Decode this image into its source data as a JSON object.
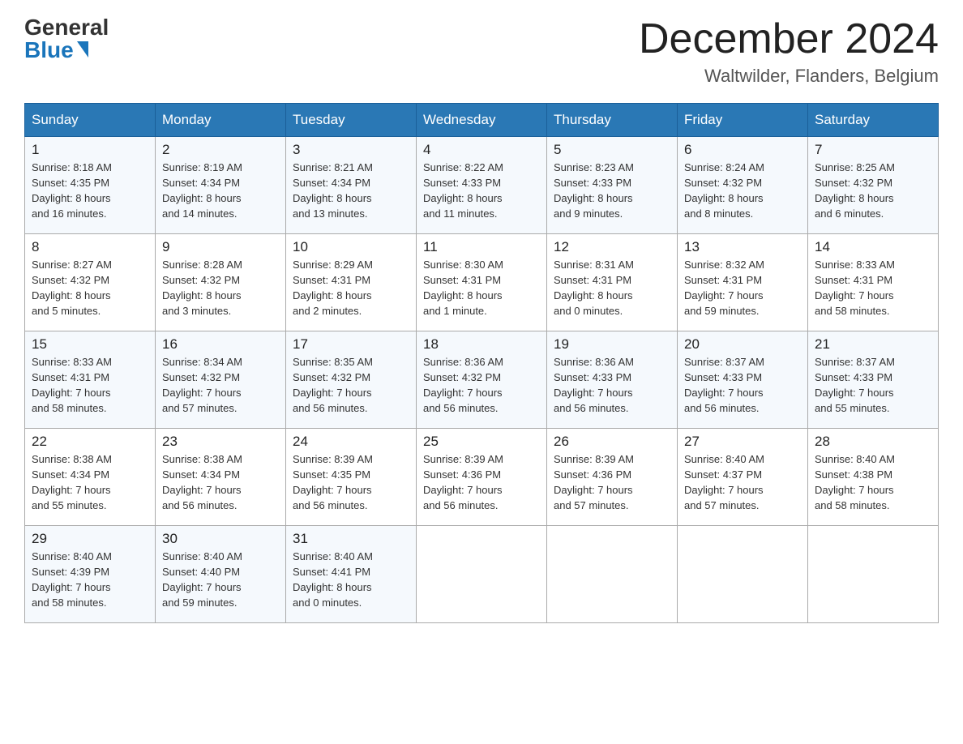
{
  "logo": {
    "general": "General",
    "blue": "Blue"
  },
  "title": "December 2024",
  "location": "Waltwilder, Flanders, Belgium",
  "weekdays": [
    "Sunday",
    "Monday",
    "Tuesday",
    "Wednesday",
    "Thursday",
    "Friday",
    "Saturday"
  ],
  "weeks": [
    [
      {
        "day": "1",
        "sunrise": "8:18 AM",
        "sunset": "4:35 PM",
        "daylight": "8 hours and 16 minutes."
      },
      {
        "day": "2",
        "sunrise": "8:19 AM",
        "sunset": "4:34 PM",
        "daylight": "8 hours and 14 minutes."
      },
      {
        "day": "3",
        "sunrise": "8:21 AM",
        "sunset": "4:34 PM",
        "daylight": "8 hours and 13 minutes."
      },
      {
        "day": "4",
        "sunrise": "8:22 AM",
        "sunset": "4:33 PM",
        "daylight": "8 hours and 11 minutes."
      },
      {
        "day": "5",
        "sunrise": "8:23 AM",
        "sunset": "4:33 PM",
        "daylight": "8 hours and 9 minutes."
      },
      {
        "day": "6",
        "sunrise": "8:24 AM",
        "sunset": "4:32 PM",
        "daylight": "8 hours and 8 minutes."
      },
      {
        "day": "7",
        "sunrise": "8:25 AM",
        "sunset": "4:32 PM",
        "daylight": "8 hours and 6 minutes."
      }
    ],
    [
      {
        "day": "8",
        "sunrise": "8:27 AM",
        "sunset": "4:32 PM",
        "daylight": "8 hours and 5 minutes."
      },
      {
        "day": "9",
        "sunrise": "8:28 AM",
        "sunset": "4:32 PM",
        "daylight": "8 hours and 3 minutes."
      },
      {
        "day": "10",
        "sunrise": "8:29 AM",
        "sunset": "4:31 PM",
        "daylight": "8 hours and 2 minutes."
      },
      {
        "day": "11",
        "sunrise": "8:30 AM",
        "sunset": "4:31 PM",
        "daylight": "8 hours and 1 minute."
      },
      {
        "day": "12",
        "sunrise": "8:31 AM",
        "sunset": "4:31 PM",
        "daylight": "8 hours and 0 minutes."
      },
      {
        "day": "13",
        "sunrise": "8:32 AM",
        "sunset": "4:31 PM",
        "daylight": "7 hours and 59 minutes."
      },
      {
        "day": "14",
        "sunrise": "8:33 AM",
        "sunset": "4:31 PM",
        "daylight": "7 hours and 58 minutes."
      }
    ],
    [
      {
        "day": "15",
        "sunrise": "8:33 AM",
        "sunset": "4:31 PM",
        "daylight": "7 hours and 58 minutes."
      },
      {
        "day": "16",
        "sunrise": "8:34 AM",
        "sunset": "4:32 PM",
        "daylight": "7 hours and 57 minutes."
      },
      {
        "day": "17",
        "sunrise": "8:35 AM",
        "sunset": "4:32 PM",
        "daylight": "7 hours and 56 minutes."
      },
      {
        "day": "18",
        "sunrise": "8:36 AM",
        "sunset": "4:32 PM",
        "daylight": "7 hours and 56 minutes."
      },
      {
        "day": "19",
        "sunrise": "8:36 AM",
        "sunset": "4:33 PM",
        "daylight": "7 hours and 56 minutes."
      },
      {
        "day": "20",
        "sunrise": "8:37 AM",
        "sunset": "4:33 PM",
        "daylight": "7 hours and 56 minutes."
      },
      {
        "day": "21",
        "sunrise": "8:37 AM",
        "sunset": "4:33 PM",
        "daylight": "7 hours and 55 minutes."
      }
    ],
    [
      {
        "day": "22",
        "sunrise": "8:38 AM",
        "sunset": "4:34 PM",
        "daylight": "7 hours and 55 minutes."
      },
      {
        "day": "23",
        "sunrise": "8:38 AM",
        "sunset": "4:34 PM",
        "daylight": "7 hours and 56 minutes."
      },
      {
        "day": "24",
        "sunrise": "8:39 AM",
        "sunset": "4:35 PM",
        "daylight": "7 hours and 56 minutes."
      },
      {
        "day": "25",
        "sunrise": "8:39 AM",
        "sunset": "4:36 PM",
        "daylight": "7 hours and 56 minutes."
      },
      {
        "day": "26",
        "sunrise": "8:39 AM",
        "sunset": "4:36 PM",
        "daylight": "7 hours and 57 minutes."
      },
      {
        "day": "27",
        "sunrise": "8:40 AM",
        "sunset": "4:37 PM",
        "daylight": "7 hours and 57 minutes."
      },
      {
        "day": "28",
        "sunrise": "8:40 AM",
        "sunset": "4:38 PM",
        "daylight": "7 hours and 58 minutes."
      }
    ],
    [
      {
        "day": "29",
        "sunrise": "8:40 AM",
        "sunset": "4:39 PM",
        "daylight": "7 hours and 58 minutes."
      },
      {
        "day": "30",
        "sunrise": "8:40 AM",
        "sunset": "4:40 PM",
        "daylight": "7 hours and 59 minutes."
      },
      {
        "day": "31",
        "sunrise": "8:40 AM",
        "sunset": "4:41 PM",
        "daylight": "8 hours and 0 minutes."
      },
      null,
      null,
      null,
      null
    ]
  ]
}
